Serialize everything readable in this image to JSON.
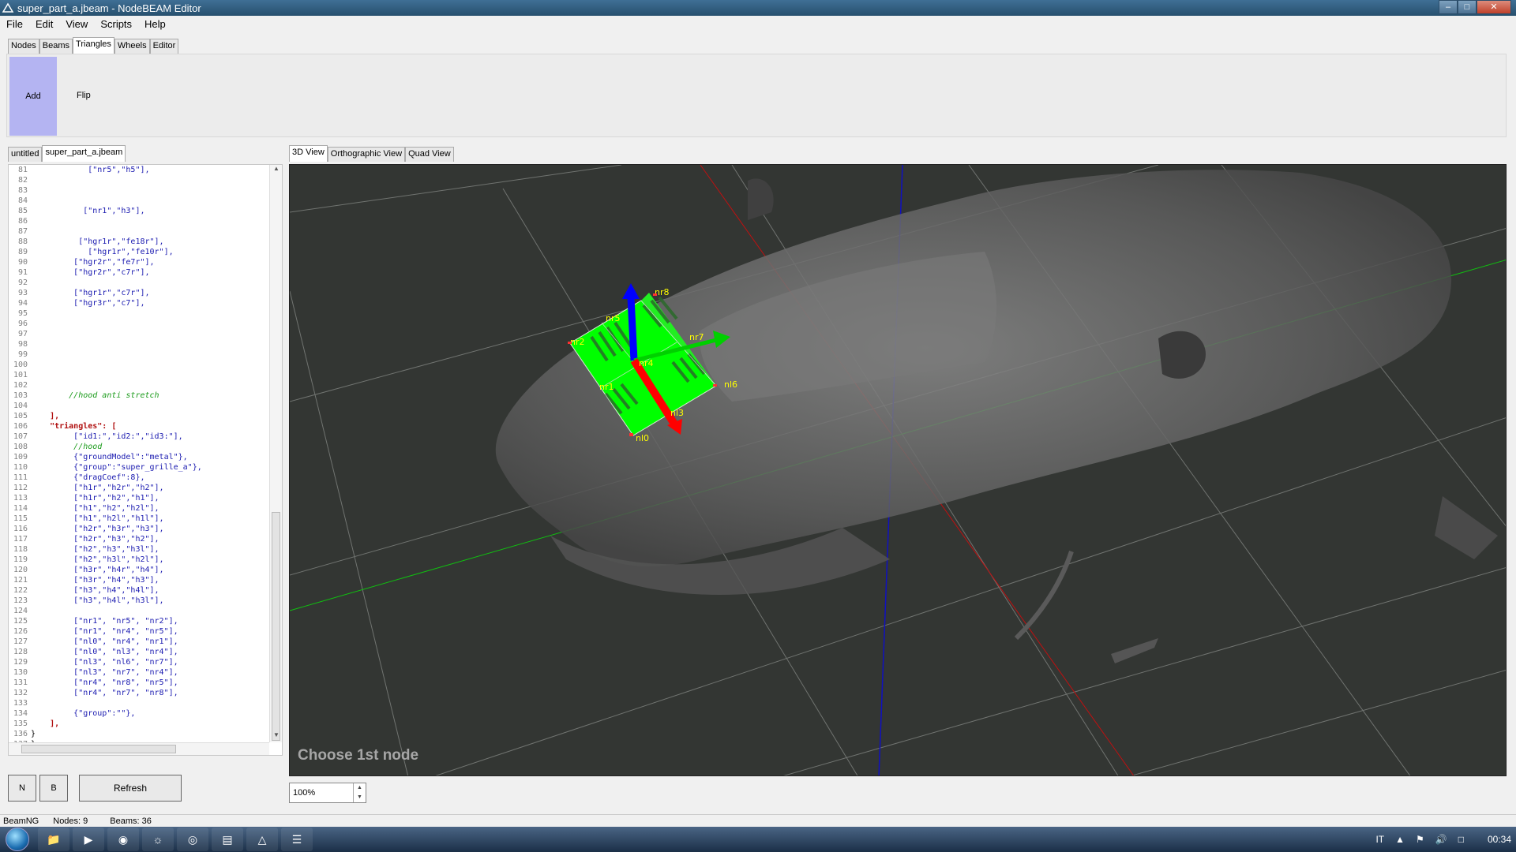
{
  "window": {
    "title": "super_part_a.jbeam - NodeBEAM Editor"
  },
  "menu": [
    "File",
    "Edit",
    "View",
    "Scripts",
    "Help"
  ],
  "tool_tabs": [
    "Nodes",
    "Beams",
    "Triangles",
    "Wheels",
    "Editor"
  ],
  "tools": {
    "add": "Add",
    "flip": "Flip"
  },
  "file_tabs": [
    "untitled",
    "super_part_a.jbeam"
  ],
  "code": [
    {
      "n": "81",
      "t": "            [\"nr5\",\"h5\"],",
      "c": "lt"
    },
    {
      "n": "82",
      "t": "",
      "c": "lt"
    },
    {
      "n": "83",
      "t": "",
      "c": "lt"
    },
    {
      "n": "84",
      "t": "",
      "c": "lt"
    },
    {
      "n": "85",
      "t": "           [\"nr1\",\"h3\"],",
      "c": "lt"
    },
    {
      "n": "86",
      "t": "",
      "c": "lt"
    },
    {
      "n": "87",
      "t": "",
      "c": "lt"
    },
    {
      "n": "88",
      "t": "          [\"hgr1r\",\"fe18r\"],",
      "c": "lt"
    },
    {
      "n": "89",
      "t": "            [\"hgr1r\",\"fe10r\"],",
      "c": "lt"
    },
    {
      "n": "90",
      "t": "         [\"hgr2r\",\"fe7r\"],",
      "c": "lt"
    },
    {
      "n": "91",
      "t": "         [\"hgr2r\",\"c7r\"],",
      "c": "lt"
    },
    {
      "n": "92",
      "t": "",
      "c": "lt"
    },
    {
      "n": "93",
      "t": "         [\"hgr1r\",\"c7r\"],",
      "c": "lt"
    },
    {
      "n": "94",
      "t": "         [\"hgr3r\",\"c7\"],",
      "c": "lt"
    },
    {
      "n": "95",
      "t": "",
      "c": "lt"
    },
    {
      "n": "96",
      "t": "",
      "c": "lt"
    },
    {
      "n": "97",
      "t": "",
      "c": "lt"
    },
    {
      "n": "98",
      "t": "",
      "c": "lt"
    },
    {
      "n": "99",
      "t": "",
      "c": "lt"
    },
    {
      "n": "100",
      "t": "",
      "c": "lt"
    },
    {
      "n": "101",
      "t": "",
      "c": "lt"
    },
    {
      "n": "102",
      "t": "",
      "c": "lt"
    },
    {
      "n": "103",
      "t": "        //hood anti stretch",
      "c": "lt comment"
    },
    {
      "n": "104",
      "t": "",
      "c": "lt"
    },
    {
      "n": "105",
      "t": "    ],",
      "c": "lt keyword"
    },
    {
      "n": "106",
      "t": "    \"triangles\": [",
      "c": "lt keyword"
    },
    {
      "n": "107",
      "t": "         [\"id1:\",\"id2:\",\"id3:\"],",
      "c": "lt"
    },
    {
      "n": "108",
      "t": "         //hood",
      "c": "lt comment"
    },
    {
      "n": "109",
      "t": "         {\"groundModel\":\"metal\"},",
      "c": "lt"
    },
    {
      "n": "110",
      "t": "         {\"group\":\"super_grille_a\"},",
      "c": "lt"
    },
    {
      "n": "111",
      "t": "         {\"dragCoef\":8},",
      "c": "lt"
    },
    {
      "n": "112",
      "t": "         [\"h1r\",\"h2r\",\"h2\"],",
      "c": "lt"
    },
    {
      "n": "113",
      "t": "         [\"h1r\",\"h2\",\"h1\"],",
      "c": "lt"
    },
    {
      "n": "114",
      "t": "         [\"h1\",\"h2\",\"h2l\"],",
      "c": "lt"
    },
    {
      "n": "115",
      "t": "         [\"h1\",\"h2l\",\"h1l\"],",
      "c": "lt"
    },
    {
      "n": "116",
      "t": "         [\"h2r\",\"h3r\",\"h3\"],",
      "c": "lt"
    },
    {
      "n": "117",
      "t": "         [\"h2r\",\"h3\",\"h2\"],",
      "c": "lt"
    },
    {
      "n": "118",
      "t": "         [\"h2\",\"h3\",\"h3l\"],",
      "c": "lt"
    },
    {
      "n": "119",
      "t": "         [\"h2\",\"h3l\",\"h2l\"],",
      "c": "lt"
    },
    {
      "n": "120",
      "t": "         [\"h3r\",\"h4r\",\"h4\"],",
      "c": "lt"
    },
    {
      "n": "121",
      "t": "         [\"h3r\",\"h4\",\"h3\"],",
      "c": "lt"
    },
    {
      "n": "122",
      "t": "         [\"h3\",\"h4\",\"h4l\"],",
      "c": "lt"
    },
    {
      "n": "123",
      "t": "         [\"h3\",\"h4l\",\"h3l\"],",
      "c": "lt"
    },
    {
      "n": "124",
      "t": "",
      "c": "lt"
    },
    {
      "n": "125",
      "t": "         [\"nr1\", \"nr5\", \"nr2\"],",
      "c": "lt"
    },
    {
      "n": "126",
      "t": "         [\"nr1\", \"nr4\", \"nr5\"],",
      "c": "lt"
    },
    {
      "n": "127",
      "t": "         [\"nl0\", \"nr4\", \"nr1\"],",
      "c": "lt"
    },
    {
      "n": "128",
      "t": "         [\"nl0\", \"nl3\", \"nr4\"],",
      "c": "lt"
    },
    {
      "n": "129",
      "t": "         [\"nl3\", \"nl6\", \"nr7\"],",
      "c": "lt"
    },
    {
      "n": "130",
      "t": "         [\"nl3\", \"nr7\", \"nr4\"],",
      "c": "lt"
    },
    {
      "n": "131",
      "t": "         [\"nr4\", \"nr8\", \"nr5\"],",
      "c": "lt"
    },
    {
      "n": "132",
      "t": "         [\"nr4\", \"nr7\", \"nr8\"],",
      "c": "lt"
    },
    {
      "n": "133",
      "t": "",
      "c": "lt"
    },
    {
      "n": "134",
      "t": "         {\"group\":\"\"},",
      "c": "lt"
    },
    {
      "n": "135",
      "t": "    ],",
      "c": "lt keyword"
    },
    {
      "n": "136",
      "t": "}",
      "c": "lt plain"
    },
    {
      "n": "137",
      "t": "}",
      "c": "lt plain"
    }
  ],
  "left_buttons": {
    "n": "N",
    "b": "B",
    "refresh": "Refresh"
  },
  "view_tabs": [
    "3D View",
    "Orthographic View",
    "Quad View"
  ],
  "viewport": {
    "status": "Choose 1st node",
    "node_labels": [
      "nr8",
      "nr5",
      "nr2",
      "nr7",
      "nr4",
      "nr1",
      "nl6",
      "nl3",
      "nl0"
    ],
    "colors": {
      "mesh": "#00ff00",
      "x_axis": "#ff0000",
      "y_axis": "#00c000",
      "z_axis": "#0000ff",
      "label": "#ffff00"
    }
  },
  "zoom": "100%",
  "statusbar": {
    "app": "BeamNG",
    "nodes": "Nodes: 9",
    "beams": "Beams: 36"
  },
  "taskbar": {
    "lang": "IT",
    "clock": "00:34"
  }
}
